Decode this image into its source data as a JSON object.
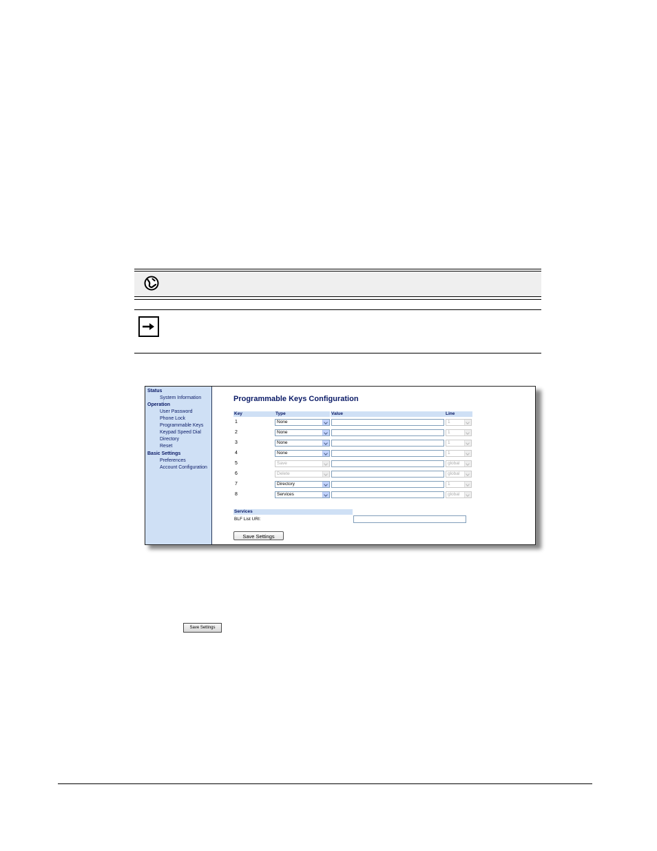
{
  "sidebar": {
    "sections": [
      {
        "heading": "Status",
        "items": [
          "System Information"
        ]
      },
      {
        "heading": "Operation",
        "items": [
          "User Password",
          "Phone Lock",
          "Programmable Keys",
          "Keypad Speed Dial",
          "Directory",
          "Reset"
        ]
      },
      {
        "heading": "Basic Settings",
        "items": [
          "Preferences",
          "Account Configuration"
        ]
      }
    ]
  },
  "main": {
    "title": "Programmable Keys Configuration",
    "columns": {
      "key": "Key",
      "type": "Type",
      "value": "Value",
      "line": "Line"
    },
    "rows": [
      {
        "key": "1",
        "type": "None",
        "type_enabled": true,
        "value": "",
        "line": "1",
        "line_enabled": false
      },
      {
        "key": "2",
        "type": "None",
        "type_enabled": true,
        "value": "",
        "line": "1",
        "line_enabled": false
      },
      {
        "key": "3",
        "type": "None",
        "type_enabled": true,
        "value": "",
        "line": "1",
        "line_enabled": false
      },
      {
        "key": "4",
        "type": "None",
        "type_enabled": true,
        "value": "",
        "line": "1",
        "line_enabled": false
      },
      {
        "key": "5",
        "type": "Save",
        "type_enabled": false,
        "value": "",
        "line": "global",
        "line_enabled": false
      },
      {
        "key": "6",
        "type": "Delete",
        "type_enabled": false,
        "value": "",
        "line": "global",
        "line_enabled": false
      },
      {
        "key": "7",
        "type": "Directory",
        "type_enabled": true,
        "value": "",
        "line": "1",
        "line_enabled": false
      },
      {
        "key": "8",
        "type": "Services",
        "type_enabled": true,
        "value": "",
        "line": "global",
        "line_enabled": false
      }
    ],
    "services_heading": "Services",
    "blf_label": "BLF List URI:",
    "blf_value": "",
    "save_label": "Save Settings"
  },
  "inline_button_label": "Save Settings",
  "icons": {
    "note1": "globe-phone-icon",
    "note2": "arrow-right-icon"
  }
}
